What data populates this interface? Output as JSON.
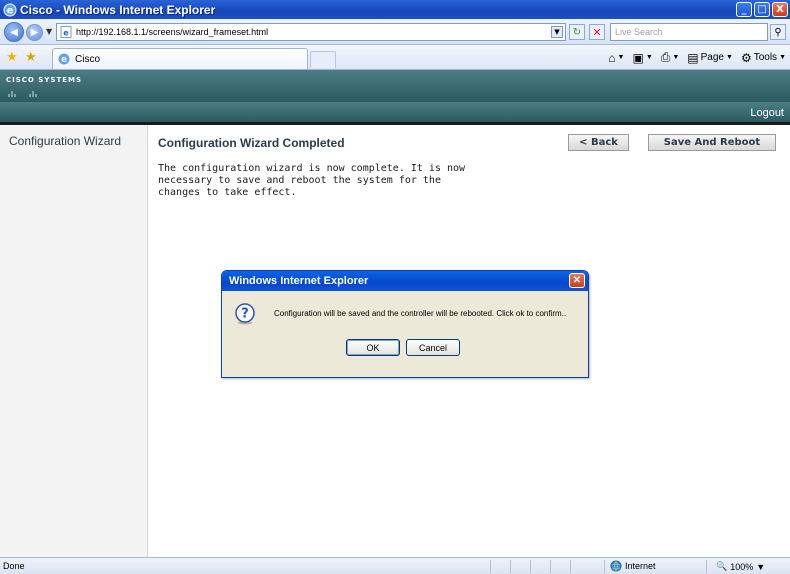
{
  "window": {
    "title": "Cisco - Windows Internet Explorer",
    "minimize": "_",
    "maximize": "□",
    "close": "X"
  },
  "address": {
    "url": "http://192.168.1.1/screens/wizard_frameset.html",
    "search_placeholder": "Live Search"
  },
  "tab": {
    "title": "Cisco"
  },
  "commandbar": {
    "page_label": "Page",
    "tools_label": "Tools"
  },
  "cisco": {
    "logo_text": "CISCO SYSTEMS",
    "logout_label": "Logout"
  },
  "sidebar": {
    "title": "Configuration Wizard"
  },
  "main": {
    "heading": "Configuration Wizard Completed",
    "back_label": "< Back",
    "save_reboot_label": "Save And Reboot",
    "description": "The configuration wizard is now complete. It is now necessary to save and reboot the system for the changes to take effect."
  },
  "dialog": {
    "title": "Windows Internet Explorer",
    "message": "Configuration will be saved and the controller will be rebooted. Click ok to confirm..",
    "ok_label": "OK",
    "cancel_label": "Cancel"
  },
  "statusbar": {
    "status": "Done",
    "zone": "Internet",
    "zoom": "100%"
  }
}
